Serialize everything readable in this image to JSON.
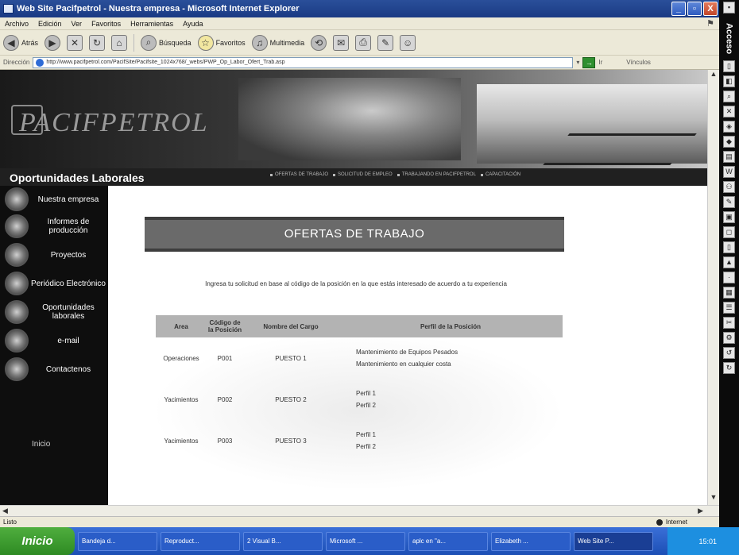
{
  "window": {
    "title": "Web Site Pacifpetrol - Nuestra empresa - Microsoft Internet Explorer",
    "buttons": [
      "_",
      "▫",
      "X"
    ]
  },
  "menubar": [
    "Archivo",
    "Edición",
    "Ver",
    "Favoritos",
    "Herramientas",
    "Ayuda"
  ],
  "toolbar": {
    "back": "Atrás",
    "search": "Búsqueda",
    "favorites": "Favoritos",
    "multimedia": "Multimedia"
  },
  "addressbar": {
    "label": "Dirección",
    "url": "http://www.pacifpetrol.com/PacifSite/Pacifsite_1024x768/_webs/PWP_Op_Labor_Ofert_Trab.asp",
    "go": "Ir",
    "links": "Vínculos"
  },
  "acceso": {
    "title": "Acceso"
  },
  "site": {
    "logo": "PACIFPETROL",
    "section_title": "Oportunidades Laborales",
    "top_nav": [
      "OFERTAS DE TRABAJO",
      "SOLICITUD DE EMPLEO",
      "TRABAJANDO EN PACIFPETROL",
      "CAPACITACIÓN"
    ],
    "left_nav": [
      "Nuestra empresa",
      "Informes de producción",
      "Proyectos",
      "Periódico Electrónico",
      "Oportunidades laborales",
      "e-mail",
      "Contactenos"
    ],
    "inicio": "Inicio"
  },
  "content": {
    "heading": "OFERTAS DE TRABAJO",
    "intro": "Ingresa tu solicitud en base al código de la posición en la que estás interesado de acuerdo a tu experiencia",
    "table": {
      "headers": [
        "Area",
        "Código de la Posición",
        "Nombre del Cargo",
        "Perfil de la Posición"
      ],
      "rows": [
        {
          "area": "Operaciones",
          "code": "P001",
          "name": "PUESTO 1",
          "profile": [
            "Mantenimiento de Equipos Pesados",
            "Mantenimiento en cualquier costa"
          ]
        },
        {
          "area": "Yacimientos",
          "code": "P002",
          "name": "PUESTO 2",
          "profile": [
            "Perfil 1",
            "Perfil 2"
          ]
        },
        {
          "area": "Yacimientos",
          "code": "P003",
          "name": "PUESTO 3",
          "profile": [
            "Perfil 1",
            "Perfil 2"
          ]
        }
      ]
    }
  },
  "statusbar": {
    "text": "Listo",
    "zone": "Internet"
  },
  "taskbar": {
    "start": "Inicio",
    "tasks": [
      "Bandeja d...",
      "Reproduct...",
      "2 Visual B...",
      "Microsoft ...",
      "aplc en \"a...",
      "Elizabeth ...",
      "Web Site P..."
    ],
    "clock": "15:01"
  }
}
